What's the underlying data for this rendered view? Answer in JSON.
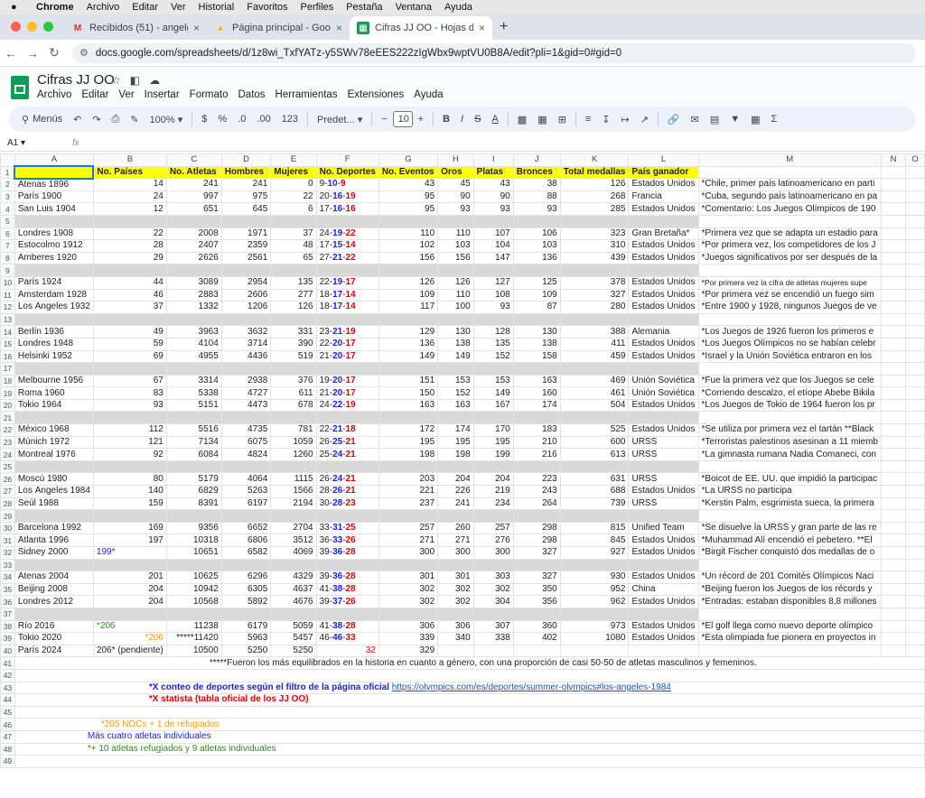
{
  "macbar": {
    "apple": "",
    "app": "Chrome",
    "menus": [
      "Archivo",
      "Editar",
      "Ver",
      "Historial",
      "Favoritos",
      "Perfiles",
      "Pestaña",
      "Ventana",
      "Ayuda"
    ]
  },
  "tabs": [
    {
      "label": "Recibidos (51) - angelgrafico",
      "icon": "gmail-icon"
    },
    {
      "label": "Página principal - Google Driv",
      "icon": "drive-icon"
    },
    {
      "label": "Cifras JJ OO - Hojas de cálcu",
      "icon": "sheets-icon"
    }
  ],
  "url": "docs.google.com/spreadsheets/d/1z8wi_TxfYATz-y5SWv78eEES222zIgWbx9wptVU0B8A/edit?pli=1&gid=0#gid=0",
  "doc": {
    "title": "Cifras JJ OO",
    "menus": [
      "Archivo",
      "Editar",
      "Ver",
      "Insertar",
      "Formato",
      "Datos",
      "Herramientas",
      "Extensiones",
      "Ayuda"
    ]
  },
  "toolbar": {
    "search": "Menús",
    "zoom": "100%",
    "currency": "$",
    "percent": "%",
    "dec_less": ".0",
    "dec_more": ".00",
    "num": "123",
    "font": "Predet...",
    "font_size": "10"
  },
  "formula": {
    "cell": "A1",
    "fx": "fx"
  },
  "columns": [
    "A",
    "B",
    "C",
    "D",
    "E",
    "F",
    "G",
    "H",
    "I",
    "J",
    "K",
    "L",
    "M",
    "N",
    "O"
  ],
  "header_row": [
    "",
    "No. Países",
    "No. Atletas",
    "Hombres",
    "Mujeres",
    "No. Deportes",
    "No. Eventos",
    "Oros",
    "Platas",
    "Bronces",
    "Total medallas",
    "País ganador"
  ],
  "rows": [
    {
      "n": 2,
      "c": [
        "Atenas 1896",
        "14",
        "241",
        "241",
        "0",
        [
          "9",
          "10",
          "9"
        ],
        "43",
        "45",
        "43",
        "38",
        "126",
        "Estados Unidos",
        "*Chile, primer país latinoamericano en parti"
      ]
    },
    {
      "n": 3,
      "c": [
        "París 1900",
        "24",
        "997",
        "975",
        "22",
        [
          "20",
          "16",
          "19"
        ],
        "95",
        "90",
        "90",
        "88",
        "268",
        "Francia",
        "*Cuba, segundo país latinoamericano en pa"
      ]
    },
    {
      "n": 4,
      "c": [
        "San Luis 1904",
        "12",
        "651",
        "645",
        "6",
        [
          "17",
          "16",
          "16"
        ],
        "95",
        "93",
        "93",
        "93",
        "285",
        "Estados Unidos",
        "*Comentario: Los Juegos Olímpicos de 190"
      ]
    },
    {
      "n": 5,
      "gray": true
    },
    {
      "n": 6,
      "c": [
        "Londres 1908",
        "22",
        "2008",
        "1971",
        "37",
        [
          "24",
          "19",
          "22"
        ],
        "110",
        "110",
        "107",
        "106",
        "323",
        "Gran Bretaña*",
        "*Primera vez que se adapta un estadio para"
      ]
    },
    {
      "n": 7,
      "c": [
        "Estocolmo 1912",
        "28",
        "2407",
        "2359",
        "48",
        [
          "17",
          "15",
          "14"
        ],
        "102",
        "103",
        "104",
        "103",
        "310",
        "Estados Unidos",
        "*Por primera vez, los competidores de los J"
      ]
    },
    {
      "n": 8,
      "c": [
        "Amberes 1920",
        "29",
        "2626",
        "2561",
        "65",
        [
          "27",
          "21",
          "22"
        ],
        "156",
        "156",
        "147",
        "136",
        "439",
        "Estados Unidos",
        "*Juegos significativos por ser después de la"
      ]
    },
    {
      "n": 9,
      "gray": true
    },
    {
      "n": 10,
      "c": [
        "París 1924",
        "44",
        "3089",
        "2954",
        "135",
        [
          "22",
          "19",
          "17"
        ],
        "126",
        "126",
        "127",
        "125",
        "378",
        "Estados Unidos",
        "*Por primera vez la cifra de atletas mujeres supe"
      ],
      "small": true
    },
    {
      "n": 11,
      "c": [
        "Ámsterdam 1928",
        "46",
        "2883",
        "2606",
        "277",
        [
          "18",
          "17",
          "14"
        ],
        "109",
        "110",
        "108",
        "109",
        "327",
        "Estados Unidos",
        "*Por primera vez se encendió un fuego sim"
      ]
    },
    {
      "n": 12,
      "c": [
        "Los Ángeles 1932",
        "37",
        "1332",
        "1206",
        "126",
        [
          "18",
          "17",
          "14"
        ],
        "117",
        "100",
        "93",
        "87",
        "280",
        "Estados Unidos",
        "*Entre 1900 y 1928, ningunos Juegos de ve"
      ]
    },
    {
      "n": 13,
      "gray": true
    },
    {
      "n": 14,
      "c": [
        "Berlín 1936",
        "49",
        "3963",
        "3632",
        "331",
        [
          "23",
          "21",
          "19"
        ],
        "129",
        "130",
        "128",
        "130",
        "388",
        "Alemania",
        "*Los Juegos de 1926 fueron los primeros e"
      ]
    },
    {
      "n": 15,
      "c": [
        "Londres 1948",
        "59",
        "4104",
        "3714",
        "390",
        [
          "22",
          "20",
          "17"
        ],
        "136",
        "138",
        "135",
        "138",
        "411",
        "Estados Unidos",
        "*Los Juegos Olímpicos no se habían celebr"
      ]
    },
    {
      "n": 16,
      "c": [
        "Helsinki 1952",
        "69",
        "4955",
        "4436",
        "519",
        [
          "21",
          "20",
          "17"
        ],
        "149",
        "149",
        "152",
        "158",
        "459",
        "Estados Unidos",
        "*Israel y la Unión Soviética entraron en los"
      ]
    },
    {
      "n": 17,
      "gray": true
    },
    {
      "n": 18,
      "c": [
        "Melbourne 1956",
        "67",
        "3314",
        "2938",
        "376",
        [
          "19",
          "20",
          "17"
        ],
        "151",
        "153",
        "153",
        "163",
        "469",
        "Unión Soviética",
        "*Fue la primera vez que los Juegos se cele"
      ]
    },
    {
      "n": 19,
      "c": [
        "Roma 1960",
        "83",
        "5338",
        "4727",
        "611",
        [
          "21",
          "20",
          "17"
        ],
        "150",
        "152",
        "149",
        "160",
        "461",
        "Unión Soviética",
        "*Corriendo descalzo, el etíope Abebe Bikila"
      ]
    },
    {
      "n": 20,
      "c": [
        "Tokio 1964",
        "93",
        "5151",
        "4473",
        "678",
        [
          "24",
          "22",
          "19"
        ],
        "163",
        "163",
        "167",
        "174",
        "504",
        "Estados Unidos",
        "*Los Juegos de Tokio de 1964 fueron los pr"
      ]
    },
    {
      "n": 21,
      "gray": true
    },
    {
      "n": 22,
      "c": [
        "México 1968",
        "112",
        "5516",
        "4735",
        "781",
        [
          "22",
          "21",
          "18"
        ],
        "172",
        "174",
        "170",
        "183",
        "525",
        "Estados Unidos",
        "*Se utiliza por primera vez el tartán **Black"
      ]
    },
    {
      "n": 23,
      "c": [
        "Múnich 1972",
        "121",
        "7134",
        "6075",
        "1059",
        [
          "26",
          "25",
          "21"
        ],
        "195",
        "195",
        "195",
        "210",
        "600",
        "URSS",
        "*Terroristas palestinos asesinan a 11 miemb"
      ]
    },
    {
      "n": 24,
      "c": [
        "Montreal 1976",
        "92",
        "6084",
        "4824",
        "1260",
        [
          "25",
          "24",
          "21"
        ],
        "198",
        "198",
        "199",
        "216",
        "613",
        "URSS",
        "*La gimnasta rumana Nadia Comaneci, con"
      ]
    },
    {
      "n": 25,
      "gray": true
    },
    {
      "n": 26,
      "c": [
        "Moscú 1980",
        "80",
        "5179",
        "4064",
        "1115",
        [
          "26",
          "24",
          "21"
        ],
        "203",
        "204",
        "204",
        "223",
        "631",
        "URSS",
        "*Boicot de EE. UU. que impidió la participac"
      ]
    },
    {
      "n": 27,
      "c": [
        "Los Ángeles 1984",
        "140",
        "6829",
        "5263",
        "1566",
        [
          "28",
          "26",
          "21"
        ],
        "221",
        "226",
        "219",
        "243",
        "688",
        "Estados Unidos",
        "*La URSS no participa"
      ]
    },
    {
      "n": 28,
      "c": [
        "Seúl 1988",
        "159",
        "8391",
        "6197",
        "2194",
        [
          "30",
          "28",
          "23"
        ],
        "237",
        "241",
        "234",
        "264",
        "739",
        "URSS",
        "*Kerstin Palm, esgrimista sueca, la primera"
      ]
    },
    {
      "n": 29,
      "gray": true
    },
    {
      "n": 30,
      "c": [
        "Barcelona 1992",
        "169",
        "9356",
        "6652",
        "2704",
        [
          "33",
          "31",
          "25"
        ],
        "257",
        "260",
        "257",
        "298",
        "815",
        "Unified Team",
        "*Se disuelve la URSS y gran parte de las re"
      ]
    },
    {
      "n": 31,
      "c": [
        "Atlanta 1996",
        "197",
        "10318",
        "6806",
        "3512",
        [
          "36",
          "33",
          "26"
        ],
        "271",
        "271",
        "276",
        "298",
        "845",
        "Estados Unidos",
        "*Muhammad Alí encendió el pebetero. **El"
      ]
    },
    {
      "n": 32,
      "c": [
        "Sidney 2000",
        "199*",
        "10651",
        "6582",
        "4069",
        [
          "39",
          "36",
          "28"
        ],
        "300",
        "300",
        "300",
        "327",
        "927",
        "Estados Unidos",
        "*Birgit Fischer conquistó dos medallas de o"
      ],
      "bcolor": "blue"
    },
    {
      "n": 33,
      "gray": true
    },
    {
      "n": 34,
      "c": [
        "Atenas 2004",
        "201",
        "10625",
        "6296",
        "4329",
        [
          "39",
          "36",
          "28"
        ],
        "301",
        "301",
        "303",
        "327",
        "930",
        "Estados Unidos",
        "*Un récord de 201 Comités Olímpicos Naci"
      ]
    },
    {
      "n": 35,
      "c": [
        "Beijing 2008",
        "204",
        "10942",
        "6305",
        "4637",
        [
          "41",
          "38",
          "28"
        ],
        "302",
        "302",
        "302",
        "350",
        "952",
        "China",
        "*Beijing fueron los Juegos de los récords y"
      ]
    },
    {
      "n": 36,
      "c": [
        "Londres 2012",
        "204",
        "10568",
        "5892",
        "4676",
        [
          "39",
          "37",
          "26"
        ],
        "302",
        "302",
        "304",
        "356",
        "962",
        "Estados Unidos",
        "*Entradas: estaban disponibles 8,8 millones"
      ]
    },
    {
      "n": 37,
      "gray": true
    },
    {
      "n": 38,
      "c": [
        "Río 2016",
        "*206",
        "11238",
        "6179",
        "5059",
        [
          "41",
          "38",
          "28"
        ],
        "306",
        "306",
        "307",
        "360",
        "973",
        "Estados Unidos",
        "*El golf llega como nuevo deporte olímpico"
      ],
      "bcolor": "green",
      "bleft": true
    },
    {
      "n": 39,
      "c": [
        "Tokio 2020",
        "*206",
        "*****11420",
        "5963",
        "5457",
        [
          "46",
          "46",
          "33"
        ],
        "339",
        "340",
        "338",
        "402",
        "1080",
        "Estados Unidos",
        "*Esta olimpiada fue pionera en proyectos in"
      ],
      "bcolor": "orange"
    },
    {
      "n": 40,
      "c": [
        "París 2024",
        "206* (pendiente)",
        "10500",
        "5250",
        "5250",
        [
          "",
          "32",
          ""
        ],
        "329",
        "",
        "",
        "",
        "",
        "",
        ""
      ],
      "paris": true
    }
  ],
  "notes": {
    "equilibrio": "*****Fueron los más equilibrados en la historia en cuanto a género, con una proporción de casi 50-50 de atletas masculinos y femeninos.",
    "conteo": "*X conteo de deportes según el filtro de la página oficial ",
    "conteo_link": "https://olympics.com/es/deportes/summer-olympics#los-angeles-1984",
    "estatista": "*X statista (tabla oficial de los JJ OO)",
    "nocs": "*205 NOCs + 1 de refugiados",
    "individuales": "Más cuatro atletas individuales",
    "refugiados": "*+ 10 atletas refugiados y 9 atletas individuales"
  }
}
